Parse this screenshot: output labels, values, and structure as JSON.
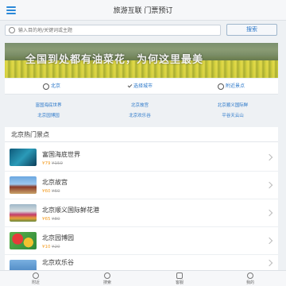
{
  "header": {
    "title": "旅游互联 门票预订"
  },
  "search": {
    "placeholder": "输入目的地/关键词或主题",
    "button_label": "搜索"
  },
  "banner": {
    "text": "全国到处都有油菜花，为何这里最美"
  },
  "quicknav": [
    {
      "label": "北京",
      "icon": "globe-icon"
    },
    {
      "label": "选择城市",
      "icon": "check-icon"
    },
    {
      "label": "附近景点",
      "icon": "location-icon"
    }
  ],
  "categories": [
    "富国海底世界",
    "北京故宫",
    "北京顺义国际鲜",
    "北京园博园",
    "北京欢乐谷",
    "平谷天云山"
  ],
  "hot": {
    "title": "北京热门景点",
    "items": [
      {
        "name": "富国海底世界",
        "price": "¥79",
        "old_price": "¥150"
      },
      {
        "name": "北京故宫",
        "price": "¥60",
        "old_price": "¥60"
      },
      {
        "name": "北京顺义国际鲜花港",
        "price": "¥65",
        "old_price": "¥80"
      },
      {
        "name": "北京园博园",
        "price": "¥10",
        "old_price": "¥20"
      },
      {
        "name": "北京欢乐谷",
        "price": "",
        "old_price": ""
      }
    ]
  },
  "tabs": [
    {
      "label": "附近"
    },
    {
      "label": "搜索"
    },
    {
      "label": "客服"
    },
    {
      "label": "我的"
    }
  ]
}
